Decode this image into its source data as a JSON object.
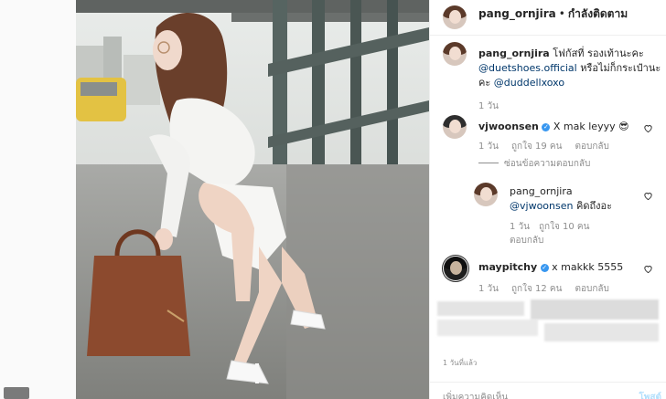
{
  "post": {
    "author": "pang_ornjira",
    "separator": "•",
    "follow_state": "กำลังติดตาม",
    "time_ago": "1 วันที่แล้ว"
  },
  "caption": {
    "username": "pang_ornjira",
    "text_1": "โฟกัสที่ รองเท้านะคะ",
    "mention_1": "@duetshoes.official",
    "text_2": "หรือไม่ก็กระเป๋านะคะ",
    "mention_2": "@duddellxoxo",
    "time": "1 วัน"
  },
  "comments": [
    {
      "username": "vjwoonsen",
      "text": "X mak leyyy",
      "emoji": "😎",
      "time": "1 วัน",
      "likes": "ถูกใจ 19 คน",
      "reply": "ตอบกลับ",
      "hide_replies": "ซ่อนข้อความตอบกลับ"
    },
    {
      "username": "pang_ornjira",
      "mention": "@vjwoonsen",
      "text": "คิดถึงอะ",
      "time": "1 วัน",
      "likes": "ถูกใจ 10 คน",
      "reply": "ตอบกลับ"
    },
    {
      "username": "maypitchy",
      "text": "x makkk 5555",
      "time": "1 วัน",
      "likes": "ถูกใจ 12 คน",
      "reply": "ตอบกลับ"
    }
  ],
  "add_comment": {
    "placeholder": "เพิ่มความคิดเห็น",
    "post_label": "โพสต์"
  },
  "colors": {
    "verified": "#3897f0",
    "mention": "#00376b",
    "meta": "#8e8e8e"
  }
}
